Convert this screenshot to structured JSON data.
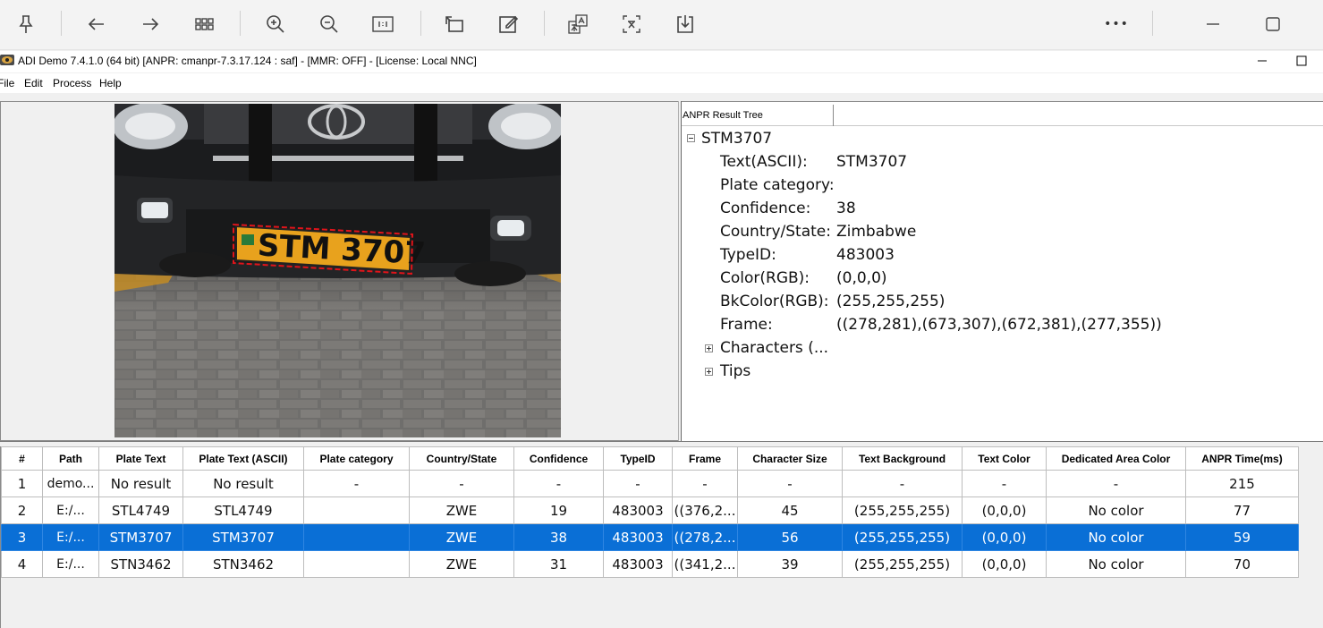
{
  "app": {
    "title": "ADI Demo 7.4.1.0 (64 bit) [ANPR: cmanpr-7.3.17.124 : saf] - [MMR: OFF] - [License: Local NNC]"
  },
  "menu": [
    "File",
    "Edit",
    "Process",
    "Help"
  ],
  "toolbar": {
    "icons": [
      "pin-icon",
      "back-icon",
      "forward-icon",
      "grid-view-icon",
      "zoom-in-icon",
      "zoom-out-icon",
      "actual-size-icon",
      "rotate-icon",
      "edit-icon",
      "translate-icon",
      "formula-icon",
      "download-icon",
      "more-icon",
      "minimize-icon",
      "maximize-icon"
    ],
    "more_label": "•••"
  },
  "image": {
    "plate_text": "STM 3707"
  },
  "tree": {
    "header": "ANPR Result Tree",
    "root": "STM3707",
    "fields": [
      {
        "key": "Text(ASCII):",
        "value": "STM3707"
      },
      {
        "key": "Plate category:",
        "value": ""
      },
      {
        "key": "Confidence:",
        "value": "38"
      },
      {
        "key": "Country/State:",
        "value": "Zimbabwe"
      },
      {
        "key": "TypeID:",
        "value": "483003"
      },
      {
        "key": "Color(RGB):",
        "value": "(0,0,0)"
      },
      {
        "key": "BkColor(RGB):",
        "value": "(255,255,255)"
      },
      {
        "key": "Frame:",
        "value": "((278,281),(673,307),(672,381),(277,355))"
      }
    ],
    "collapsed": [
      "Characters (...",
      "Tips"
    ]
  },
  "grid": {
    "columns": [
      "#",
      "Path",
      "Plate Text",
      "Plate Text (ASCII)",
      "Plate category",
      "Country/State",
      "Confidence",
      "TypeID",
      "Frame",
      "Character Size",
      "Text Background",
      "Text Color",
      "Dedicated Area Color",
      "ANPR Time(ms)"
    ],
    "rows": [
      [
        "1",
        "demo...",
        "No result",
        "No result",
        "-",
        "-",
        "-",
        "-",
        "-",
        "-",
        "-",
        "-",
        "-",
        "215"
      ],
      [
        "2",
        "E:/...",
        "STL4749",
        "STL4749",
        "",
        "ZWE",
        "19",
        "483003",
        "((376,2...",
        "45",
        "(255,255,255)",
        "(0,0,0)",
        "No color",
        "77"
      ],
      [
        "3",
        "E:/...",
        "STM3707",
        "STM3707",
        "",
        "ZWE",
        "38",
        "483003",
        "((278,2...",
        "56",
        "(255,255,255)",
        "(0,0,0)",
        "No color",
        "59"
      ],
      [
        "4",
        "E:/...",
        "STN3462",
        "STN3462",
        "",
        "ZWE",
        "31",
        "483003",
        "((341,2...",
        "39",
        "(255,255,255)",
        "(0,0,0)",
        "No color",
        "70"
      ]
    ],
    "selected_row": 2,
    "selected_color": "#0a6fd6"
  }
}
